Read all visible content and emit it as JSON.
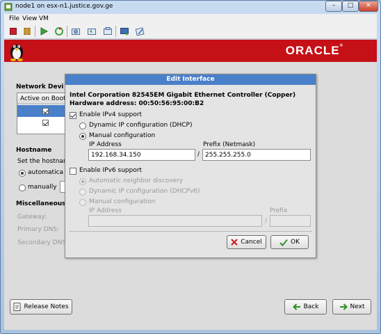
{
  "window": {
    "title": "node1 on esx-n1.justice.gov.ge",
    "minimize": "–",
    "maximize": "□",
    "close": "✕"
  },
  "menu": [
    "File",
    "View",
    "VM"
  ],
  "toolbar_icons": [
    "stop-icon",
    "pause-icon",
    "play-icon",
    "reset-icon",
    "snapshot-icon",
    "revert-snapshot-icon",
    "manage-snapshots-icon",
    "console-icon",
    "settings-icon"
  ],
  "banner": {
    "logo": "ORACLE",
    "registered": "®",
    "color": "#c51017"
  },
  "background": {
    "network_devices": {
      "heading": "Network Devi",
      "column_header": "Active on Boot",
      "rows": [
        {
          "active": true
        },
        {
          "active": true
        }
      ]
    },
    "hostname": {
      "heading": "Hostname",
      "description": "Set the hostnar",
      "automatic_label": "automatica",
      "manual_label": "manually"
    },
    "misc": {
      "heading": "Miscellaneous",
      "gateway_label": "Gateway:",
      "primary_dns_label": "Primary DNS:",
      "secondary_dns_label": "Secondary DNS"
    }
  },
  "dialog": {
    "title": "Edit Interface",
    "device_name": "Intel Corporation 82545EM Gigabit Ethernet Controller (Copper)",
    "hw_address": "Hardware address: 00:50:56:95:00:B2",
    "ipv4": {
      "enable_label": "Enable IPv4 support",
      "enabled": true,
      "dhcp_label": "Dynamic IP configuration (DHCP)",
      "manual_label": "Manual configuration",
      "mode": "manual",
      "ip_label": "IP Address",
      "ip_value": "192.168.34.150",
      "prefix_label": "Prefix (Netmask)",
      "prefix_value": "255.255.255.0",
      "separator": "/"
    },
    "ipv6": {
      "enable_label": "Enable IPv6 support",
      "enabled": false,
      "auto_label": "Automatic neighbor discovery",
      "dhcp_label": "Dynamic IP configuration (DHCPv6)",
      "manual_label": "Manual configuration",
      "ip_label": "IP Address",
      "prefix_label": "Prefix",
      "ip_value": "",
      "prefix_value": "",
      "separator": "/"
    },
    "cancel_label": "Cancel",
    "ok_label": "OK"
  },
  "footer": {
    "release_notes_label": "Release Notes",
    "back_label": "Back",
    "next_label": "Next"
  }
}
